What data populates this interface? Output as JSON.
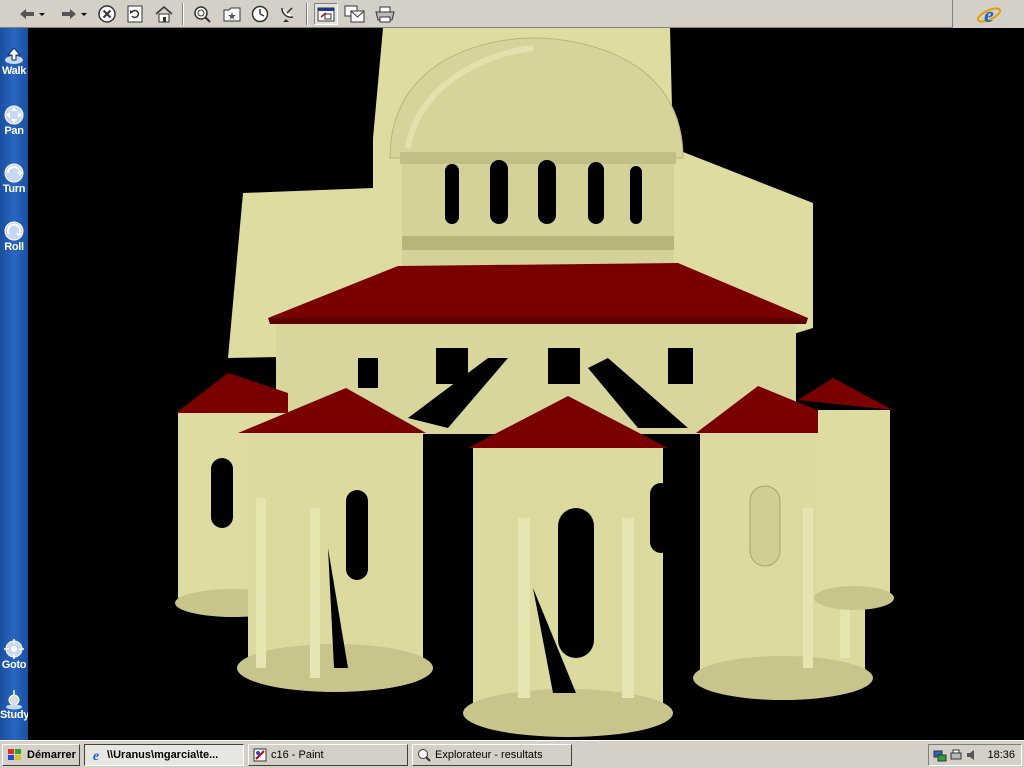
{
  "toolbar": {
    "buttons": [
      "back-button",
      "forward-button",
      "stop-button",
      "refresh-button",
      "home-button",
      "search-button",
      "favorites-button",
      "history-button",
      "channels-button",
      "fullscreen-button",
      "mail-button",
      "print-button"
    ]
  },
  "sidebar": {
    "walk_label": "Walk",
    "pan_label": "Pan",
    "turn_label": "Turn",
    "roll_label": "Roll",
    "goto_label": "Goto",
    "study_label": "Study"
  },
  "taskbar": {
    "start_label": "Démarrer",
    "tasks": [
      {
        "label": "\\\\Uranus\\mgarcia\\te..."
      },
      {
        "label": "c16 - Paint"
      },
      {
        "label": "Explorateur - resultats"
      }
    ],
    "clock": "18:36"
  },
  "colors": {
    "stone": "#dedca0",
    "stone_shadow": "#a8a46e",
    "roof": "#7a0000",
    "sidebar_blue": "#2a66c2",
    "chrome": "#d4d0c8"
  }
}
